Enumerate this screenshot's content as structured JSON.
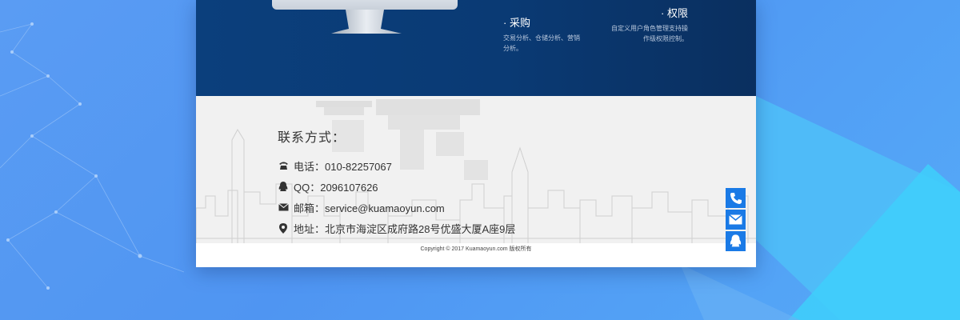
{
  "hero": {
    "monitor_logo": "",
    "features": [
      {
        "title": "· 采购",
        "desc": "交易分析、仓储分析、营销分析。"
      },
      {
        "title": "· 权限",
        "desc": "自定义用户角色管理支持操作级权限控制。"
      }
    ]
  },
  "contact": {
    "title": "联系方式：",
    "phone": "电话：010-82257067",
    "qq": "QQ：2096107626",
    "email": "邮箱：service@kuamaoyun.com",
    "address": "地址：北京市海淀区成府路28号优盛大厦A座9层"
  },
  "footer": {
    "copyright": "Copyright © 2017 Kuamaoyun.com 版权所有"
  },
  "float_buttons": [
    "phone-icon",
    "mail-icon",
    "qq-icon"
  ],
  "colors": {
    "hero_bg": "#0b3f7c",
    "footer_bg": "#f1f1f1",
    "float_button": "#1a7ae6",
    "page_bg": "#4f95f2"
  }
}
